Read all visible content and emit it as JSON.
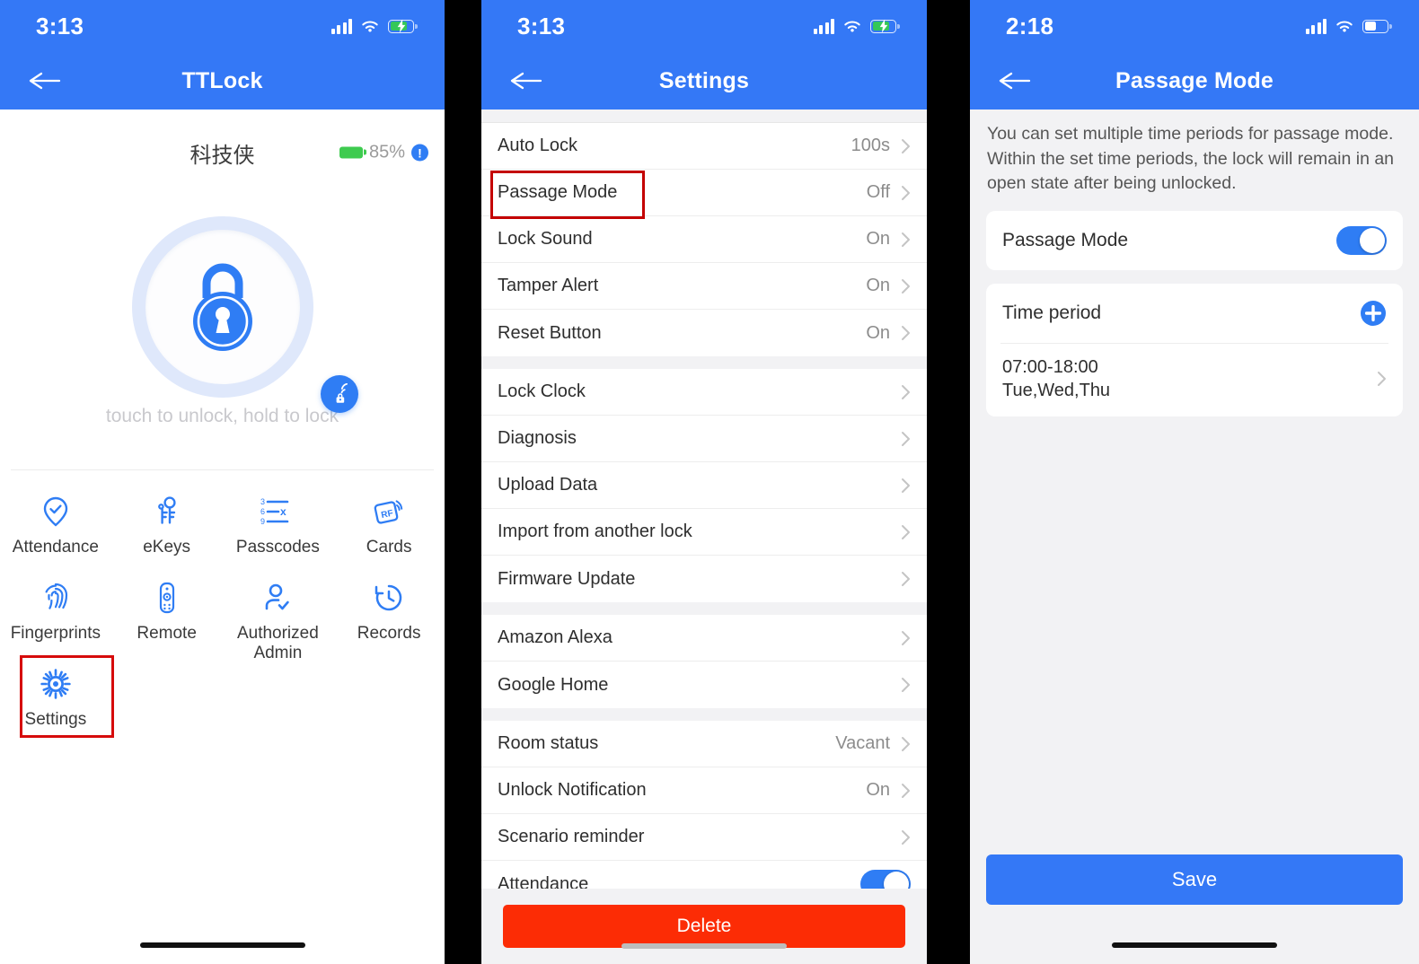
{
  "colors": {
    "header_blue": "#3478F6",
    "accent_blue": "#2F7DF4",
    "delete_red": "#FC2C05",
    "highlight_red": "#C40000",
    "battery_green": "#3ECB4F",
    "page_gray": "#F2F2F4"
  },
  "panel1": {
    "status": {
      "time": "3:13",
      "signal_icon": "signal-bars-icon",
      "wifi_icon": "wifi-icon",
      "battery_icon": "battery-charging-icon"
    },
    "nav": {
      "back_icon": "back-arrow-icon",
      "title": "TTLock"
    },
    "device": {
      "name": "科技侠",
      "battery_percent": "85%",
      "battery_icon": "battery-icon",
      "info_icon": "info-icon",
      "info_glyph": "!"
    },
    "lock": {
      "icon": "padlock-icon",
      "badge_icon": "bluetooth-lock-signal-icon"
    },
    "hint": "touch to unlock, hold to lock",
    "grid": [
      {
        "label": "Attendance",
        "icon": "attendance-check-pin-icon",
        "highlighted": false
      },
      {
        "label": "eKeys",
        "icon": "ekeys-keyring-icon",
        "highlighted": false
      },
      {
        "label": "Passcodes",
        "icon": "passcodes-keypad-icon",
        "highlighted": false
      },
      {
        "label": "Cards",
        "icon": "rf-card-icon",
        "highlighted": false
      },
      {
        "label": "Fingerprints",
        "icon": "fingerprint-icon",
        "highlighted": false
      },
      {
        "label": "Remote",
        "icon": "remote-control-icon",
        "highlighted": false
      },
      {
        "label": "Authorized\nAdmin",
        "icon": "authorized-admin-icon",
        "highlighted": false
      },
      {
        "label": "Records",
        "icon": "history-clock-icon",
        "highlighted": false
      },
      {
        "label": "Settings",
        "icon": "gear-icon",
        "highlighted": true
      }
    ]
  },
  "panel2": {
    "status": {
      "time": "3:13",
      "signal_icon": "signal-bars-icon",
      "wifi_icon": "wifi-icon",
      "battery_icon": "battery-charging-icon"
    },
    "nav": {
      "back_icon": "back-arrow-icon",
      "title": "Settings"
    },
    "groups": [
      {
        "rows": [
          {
            "label": "Auto Lock",
            "value": "100s",
            "type": "chevron",
            "highlighted": false
          },
          {
            "label": "Passage Mode",
            "value": "Off",
            "type": "chevron",
            "highlighted": true
          },
          {
            "label": "Lock Sound",
            "value": "On",
            "type": "chevron",
            "highlighted": false
          },
          {
            "label": "Tamper Alert",
            "value": "On",
            "type": "chevron",
            "highlighted": false
          },
          {
            "label": "Reset Button",
            "value": "On",
            "type": "chevron",
            "highlighted": false
          }
        ]
      },
      {
        "rows": [
          {
            "label": "Lock Clock",
            "value": "",
            "type": "chevron",
            "highlighted": false
          },
          {
            "label": "Diagnosis",
            "value": "",
            "type": "chevron",
            "highlighted": false
          },
          {
            "label": "Upload Data",
            "value": "",
            "type": "chevron",
            "highlighted": false
          },
          {
            "label": "Import from another lock",
            "value": "",
            "type": "chevron",
            "highlighted": false
          },
          {
            "label": "Firmware Update",
            "value": "",
            "type": "chevron",
            "highlighted": false
          }
        ]
      },
      {
        "rows": [
          {
            "label": "Amazon Alexa",
            "value": "",
            "type": "chevron",
            "highlighted": false
          },
          {
            "label": "Google Home",
            "value": "",
            "type": "chevron",
            "highlighted": false
          }
        ]
      },
      {
        "rows": [
          {
            "label": "Room status",
            "value": "Vacant",
            "type": "chevron",
            "highlighted": false
          },
          {
            "label": "Unlock Notification",
            "value": "On",
            "type": "chevron",
            "highlighted": false
          },
          {
            "label": "Scenario reminder",
            "value": "",
            "type": "chevron",
            "highlighted": false
          },
          {
            "label": "Attendance",
            "value": "",
            "type": "switch",
            "switch_on": true,
            "highlighted": false
          }
        ]
      }
    ],
    "delete_label": "Delete"
  },
  "panel3": {
    "status": {
      "time": "2:18",
      "signal_icon": "signal-bars-icon",
      "wifi_icon": "wifi-icon",
      "battery_icon": "battery-icon"
    },
    "nav": {
      "back_icon": "back-arrow-icon",
      "title": "Passage Mode"
    },
    "description": "You can set multiple time periods for passage mode. Within the set time periods, the lock will remain in an open state after being unlocked.",
    "passage_mode": {
      "label": "Passage Mode",
      "toggle_on": true
    },
    "time_period": {
      "label": "Time period",
      "add_icon": "add-plus-icon",
      "items": [
        {
          "time": "07:00-18:00",
          "days": "Tue,Wed,Thu"
        }
      ]
    },
    "save_label": "Save"
  }
}
